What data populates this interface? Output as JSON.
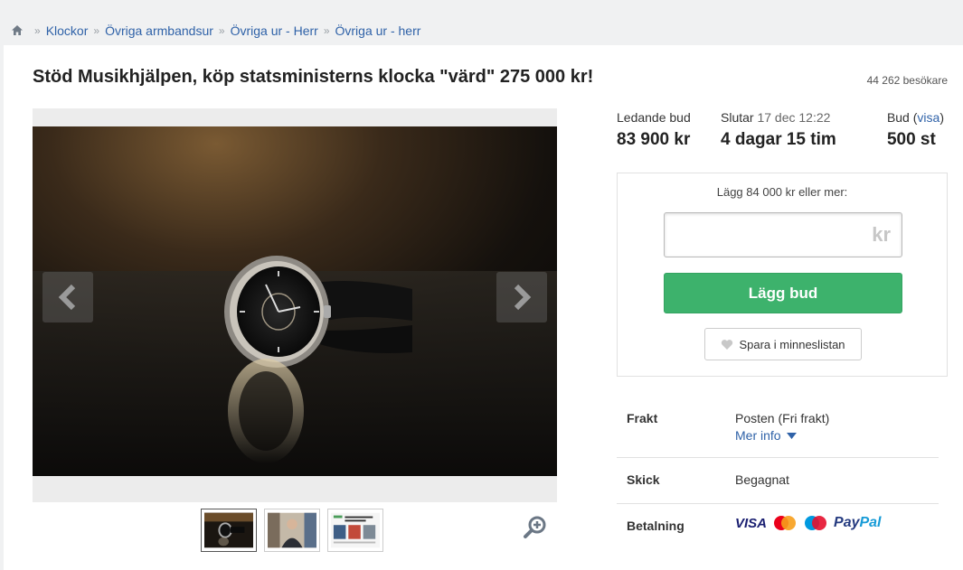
{
  "breadcrumb": {
    "home_icon": "home-icon",
    "items": [
      "Klockor",
      "Övriga armbandsur",
      "Övriga ur - Herr",
      "Övriga ur - herr"
    ]
  },
  "listing": {
    "title": "Stöd Musikhjälpen, köp statsministerns klocka \"värd\" 275 000 kr!",
    "visitors": "44 262 besökare"
  },
  "stats": {
    "leading_label": "Ledande bud",
    "leading_value": "83 900 kr",
    "ends_label": "Slutar",
    "ends_date": "17 dec 12:22",
    "ends_value": "4 dagar 15 tim",
    "bids_label": "Bud",
    "bids_link": "visa",
    "bids_value": "500 st"
  },
  "bid": {
    "hint": "Lägg 84 000 kr eller mer:",
    "input_value": "",
    "unit": "kr",
    "button": "Lägg bud",
    "save_button": "Spara i minneslistan"
  },
  "info": {
    "shipping_label": "Frakt",
    "shipping_value": "Posten (Fri frakt)",
    "more_info": "Mer info",
    "condition_label": "Skick",
    "condition_value": "Begagnat",
    "payment_label": "Betalning",
    "payment_methods": [
      "VISA",
      "mastercard",
      "maestro",
      "PayPal"
    ]
  },
  "colors": {
    "link": "#2f62a8",
    "bid_button": "#3db26c"
  }
}
